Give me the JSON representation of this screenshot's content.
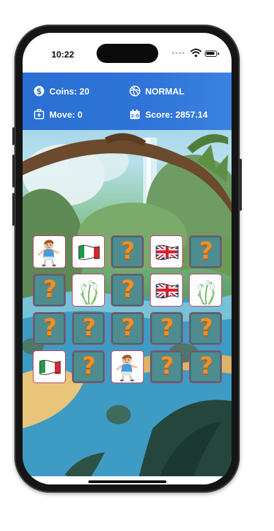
{
  "status_bar": {
    "time": "10:22"
  },
  "hud": {
    "coins": "Coins: 20",
    "mode": "NORMAL",
    "moves": "Move: 0",
    "score": "Score: 2857.14",
    "icons": {
      "coins": "dollar-coin-icon",
      "mode": "difficulty-icon",
      "moves": "medkit-icon",
      "score": "scoreboard-icon"
    }
  },
  "board": {
    "rows": 4,
    "cols": 5,
    "hidden_symbol": "?",
    "cards": [
      [
        "boy",
        "italy-flag",
        "hidden",
        "uk-flag",
        "hidden"
      ],
      [
        "hidden",
        "snowdrop-flower",
        "hidden",
        "uk-flag",
        "snowdrop-flower"
      ],
      [
        "hidden",
        "hidden",
        "hidden",
        "hidden",
        "hidden"
      ],
      [
        "italy-flag",
        "hidden",
        "boy",
        "hidden",
        "hidden"
      ]
    ]
  },
  "colors": {
    "hud": "#2f74d8",
    "card_border": "#c43b6b",
    "card_hidden": "#4f8c90",
    "question_mark": "#f0902a",
    "menu_button": "#4a8fe0"
  },
  "menu": {
    "icon": "hamburger-menu-icon"
  }
}
